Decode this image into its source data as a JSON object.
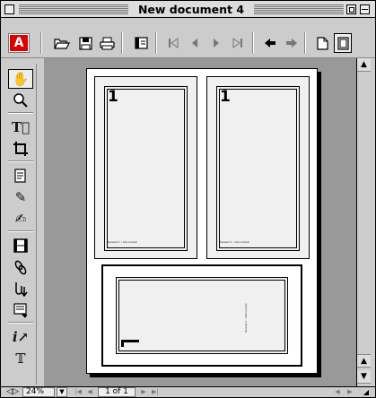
{
  "window": {
    "title": "New document 4"
  },
  "toolbar": {
    "logo_text": "A",
    "buttons": [
      {
        "name": "open-icon",
        "glyph": "🗁"
      },
      {
        "name": "save-icon",
        "glyph": "🖫"
      },
      {
        "name": "print-icon",
        "glyph": "🖶"
      },
      {
        "name": "show-hide-navigation-icon",
        "glyph": "▤"
      },
      {
        "name": "first-page-icon",
        "glyph": "|◀"
      },
      {
        "name": "previous-page-icon",
        "glyph": "◀"
      },
      {
        "name": "next-page-icon",
        "glyph": "▶"
      },
      {
        "name": "last-page-icon",
        "glyph": "▶|"
      },
      {
        "name": "go-back-icon",
        "glyph": "🡄"
      },
      {
        "name": "go-forward-icon",
        "glyph": "🡆"
      },
      {
        "name": "actual-size-icon",
        "glyph": "🗋"
      },
      {
        "name": "fit-page-icon",
        "glyph": "🗋"
      }
    ]
  },
  "tools": [
    {
      "name": "hand-tool-icon",
      "glyph": "✋"
    },
    {
      "name": "zoom-tool-icon",
      "glyph": "🔍"
    },
    {
      "name": "text-select-tool-icon",
      "glyph": "T"
    },
    {
      "name": "crop-tool-icon",
      "glyph": "⌗"
    },
    {
      "name": "note-tool-icon",
      "glyph": "🗐"
    },
    {
      "name": "pencil-tool-icon",
      "glyph": "✎"
    },
    {
      "name": "highlight-tool-icon",
      "glyph": "✍"
    },
    {
      "name": "movie-tool-icon",
      "glyph": "🎞"
    },
    {
      "name": "link-tool-icon",
      "glyph": "🔗"
    },
    {
      "name": "thread-tool-icon",
      "glyph": "⇩"
    },
    {
      "name": "form-tool-icon",
      "glyph": "▦"
    },
    {
      "name": "touchup-text-tool-icon",
      "glyph": "T"
    },
    {
      "name": "text-frame-tool-icon",
      "glyph": "T"
    }
  ],
  "pages": {
    "page1_number": "1",
    "page2_number": "1",
    "footer_text": "Spread 1 • Document"
  },
  "statusbar": {
    "zoom": "24%",
    "page_indicator": "1 of 1"
  }
}
